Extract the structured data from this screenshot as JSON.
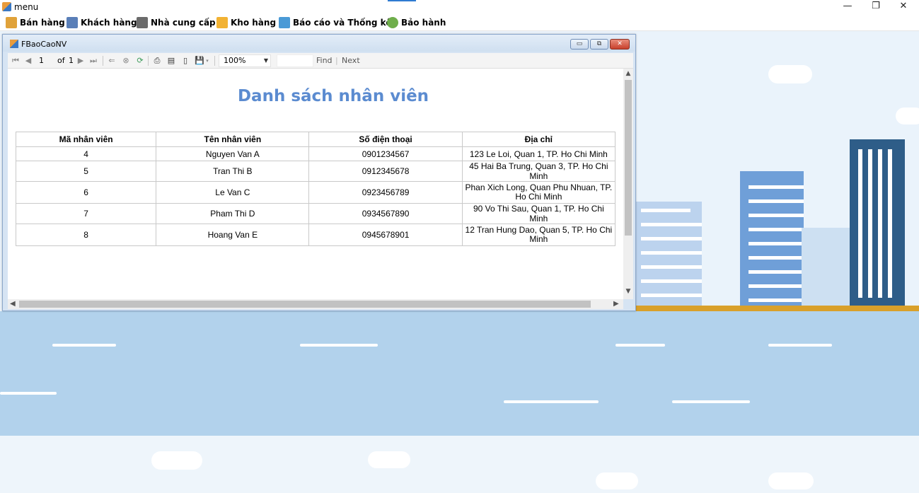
{
  "window": {
    "title": "menu",
    "min_icon": "minimize-icon",
    "max_icon": "restore-icon",
    "close_icon": "close-icon",
    "min_glyph": "—",
    "max_glyph": "❐",
    "close_glyph": "✕"
  },
  "menu": {
    "items": [
      {
        "label": "Bán hàng",
        "icon": "cart-icon",
        "color": "#e0a23a"
      },
      {
        "label": "Khách hàng",
        "icon": "people-icon",
        "color": "#5a7fb8"
      },
      {
        "label": "Nhà cung cấp",
        "icon": "supplier-icon",
        "color": "#6b6b6b"
      },
      {
        "label": "Kho hàng",
        "icon": "box-icon",
        "color": "#f2b233"
      },
      {
        "label": "Báo cáo và Thống kê",
        "icon": "report-icon",
        "color": "#4a9ad6"
      },
      {
        "label": "Bảo hành",
        "icon": "gear-icon",
        "color": "#6fae4b"
      }
    ]
  },
  "child_window": {
    "title": "FBaoCaoNV",
    "min_glyph": "▭",
    "max_glyph": "⧉",
    "close_glyph": "✕"
  },
  "toolbar": {
    "page_current": "1",
    "page_of": "of",
    "page_total": "1",
    "zoom": "100%",
    "find_label": "Find",
    "next_label": "Next",
    "separator": "|"
  },
  "report": {
    "title": "Danh sách nhân viên",
    "columns": [
      "Mã nhân viên",
      "Tên nhân viên",
      "Số điện thoại",
      "Địa chỉ"
    ],
    "rows": [
      {
        "id": "4",
        "name": "Nguyen Van A",
        "phone": "0901234567",
        "address": "123 Le Loi, Quan 1, TP. Ho Chi Minh"
      },
      {
        "id": "5",
        "name": "Tran Thi B",
        "phone": "0912345678",
        "address": "45 Hai Ba Trung, Quan 3, TP. Ho Chi Minh"
      },
      {
        "id": "6",
        "name": "Le Van C",
        "phone": "0923456789",
        "address": "Phan Xich Long, Quan Phu Nhuan, TP. Ho Chi Minh"
      },
      {
        "id": "7",
        "name": "Pham Thi D",
        "phone": "0934567890",
        "address": "90 Vo Thi Sau, Quan 1, TP. Ho Chi Minh"
      },
      {
        "id": "8",
        "name": "Hoang Van E",
        "phone": "0945678901",
        "address": "12 Tran Hung Dao, Quan 5, TP. Ho Chi Minh"
      }
    ]
  }
}
